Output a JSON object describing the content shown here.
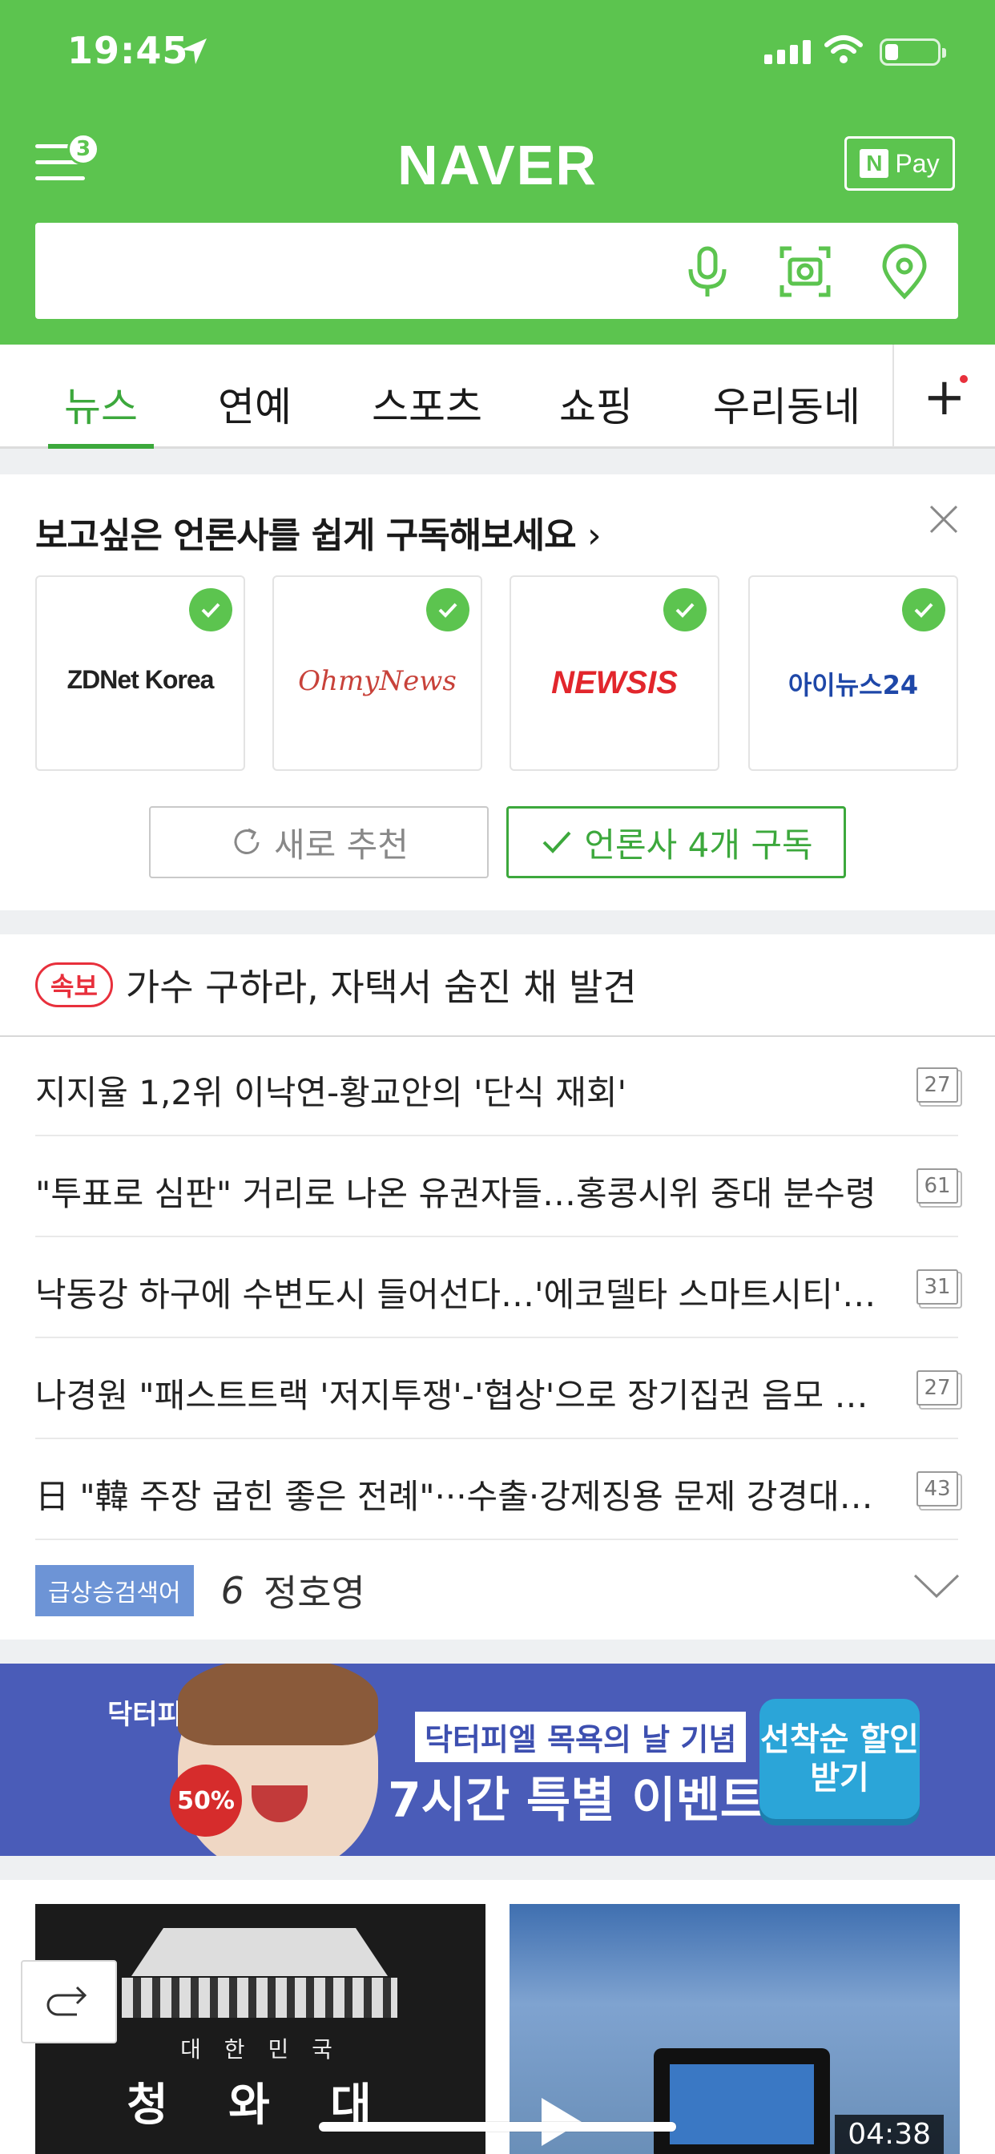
{
  "status_bar": {
    "time": "19:45"
  },
  "header": {
    "menu_badge": "3",
    "logo": "NAVER",
    "npay_n": "N",
    "npay_label": "Pay",
    "brand_color": "#5cc44f"
  },
  "search": {
    "icons": [
      "mic-icon",
      "camera-lens-icon",
      "location-pin-icon"
    ]
  },
  "tabs": {
    "items": [
      {
        "label": "뉴스",
        "active": true
      },
      {
        "label": "연예"
      },
      {
        "label": "스포츠"
      },
      {
        "label": "쇼핑"
      },
      {
        "label": "우리동네"
      }
    ],
    "plus": "+"
  },
  "subscribe": {
    "title": "보고싶은 언론사를 쉽게 구독해보세요",
    "publishers": [
      {
        "name": "ZDNet Korea"
      },
      {
        "name": "OhmyNews"
      },
      {
        "name": "NEWSIS"
      },
      {
        "name": "아이뉴스24"
      }
    ],
    "refresh_label": "새로 추천",
    "subscribe_label": "언론사 4개 구독"
  },
  "news": {
    "breaking_badge": "속보",
    "breaking_text": "가수 구하라, 자택서 숨진 채 발견",
    "items": [
      {
        "title": "지지율 1,2위 이낙연-황교안의 '단식 재회'",
        "comments": "27"
      },
      {
        "title": "\"투표로 심판\" 거리로 나온 유권자들…홍콩시위 중대 분수령",
        "comments": "61"
      },
      {
        "title": "낙동강 하구에 수변도시 들어선다…'에코델타 스마트시티' 조성",
        "comments": "31"
      },
      {
        "title": "나경원 \"패스트트랙 '저지투쟁'-'협상'으로 장기집권 음모 저지\"",
        "comments": "27"
      },
      {
        "title": "日 \"韓 주장 굽힌 좋은 전례\"···수출·강제징용 문제 강경대응 방침",
        "comments": "43"
      }
    ],
    "trending_tag": "급상승검색어",
    "trending_rank": "6",
    "trending_keyword": "정호영"
  },
  "ad": {
    "brand": "닥터피엘",
    "discount": "50%",
    "line1": "닥터피엘 목욕의 날 기념",
    "line2": "7시간 특별 이벤트",
    "cta": "선착순 할인받기"
  },
  "photos": {
    "left_text1": "대 한 민 국",
    "left_text2": "청 와 대",
    "right_duration": "04:38"
  }
}
